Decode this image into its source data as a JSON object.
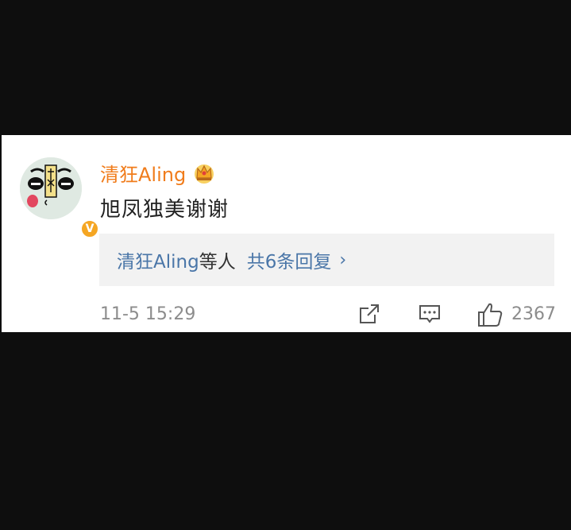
{
  "comment": {
    "username": "清狂Aling",
    "text": "旭凤独美谢谢",
    "verified_badge": "V",
    "crown_icon": "crown-icon"
  },
  "replies": {
    "users": "清狂Aling",
    "others_suffix": "等人",
    "count_text": "共6条回复",
    "chevron": "›"
  },
  "footer": {
    "timestamp": "11-5 15:29",
    "like_count": "2367",
    "icons": [
      "share-icon",
      "reply-icon",
      "like-icon"
    ]
  },
  "colors": {
    "username": "#f07c1b",
    "reply_link": "#4a76a8",
    "muted": "#8c8c8c",
    "verified": "#f5a623"
  }
}
